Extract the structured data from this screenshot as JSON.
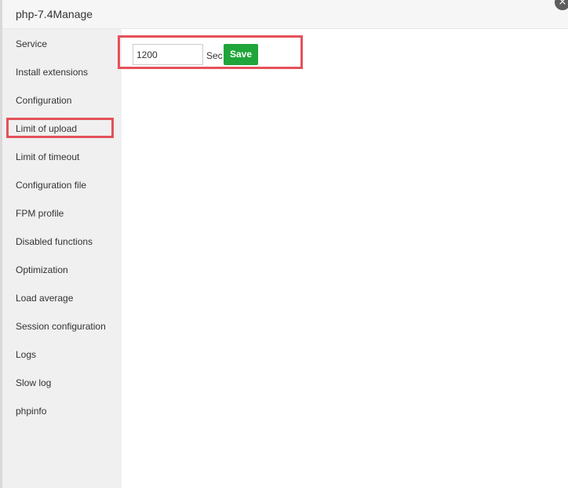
{
  "window": {
    "title": "php-7.4Manage",
    "close_glyph": "×"
  },
  "sidebar": {
    "items": [
      {
        "label": "Service"
      },
      {
        "label": "Install extensions"
      },
      {
        "label": "Configuration"
      },
      {
        "label": "Limit of upload"
      },
      {
        "label": "Limit of timeout",
        "active": true
      },
      {
        "label": "Configuration file"
      },
      {
        "label": "FPM profile"
      },
      {
        "label": "Disabled functions"
      },
      {
        "label": "Optimization"
      },
      {
        "label": "Load average"
      },
      {
        "label": "Session configuration"
      },
      {
        "label": "Logs"
      },
      {
        "label": "Slow log"
      },
      {
        "label": "phpinfo"
      }
    ]
  },
  "timeout_form": {
    "value": "1200",
    "unit": "Sec",
    "save_label": "Save"
  },
  "colors": {
    "accent_green": "#20a53a",
    "highlight_red": "#e5515a",
    "sidebar_bg": "#f0f0f0"
  }
}
